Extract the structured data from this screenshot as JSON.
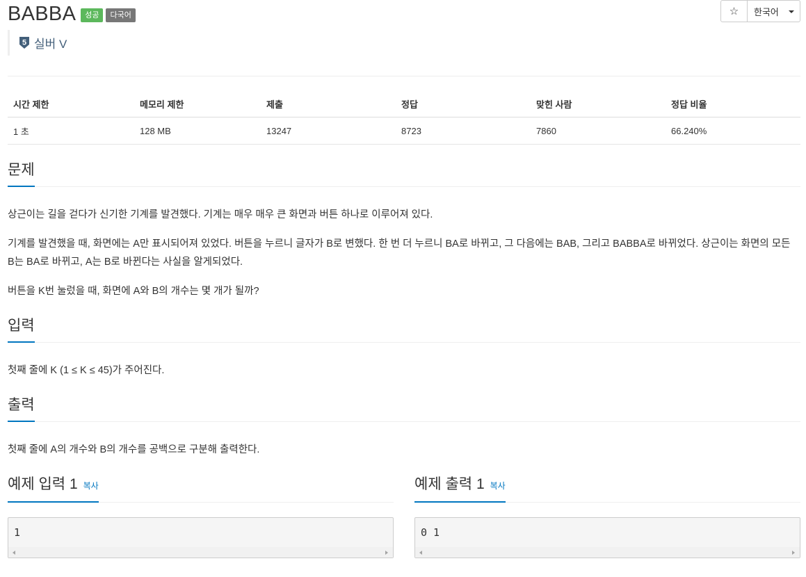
{
  "problem": {
    "title": "BABBA",
    "badges": {
      "success": "성공",
      "multilang": "다국어"
    },
    "tier": {
      "level": "5",
      "name": "실버 V",
      "color": "#435f7a"
    }
  },
  "toolbar": {
    "star_icon": "☆",
    "language": "한국어"
  },
  "info_table": {
    "headers": [
      "시간 제한",
      "메모리 제한",
      "제출",
      "정답",
      "맞힌 사람",
      "정답 비율"
    ],
    "values": [
      "1 초",
      "128 MB",
      "13247",
      "8723",
      "7860",
      "66.240%"
    ]
  },
  "sections": {
    "problem": {
      "heading": "문제",
      "paragraphs": [
        "상근이는 길을 걷다가 신기한 기계를 발견했다. 기계는 매우 매우 큰 화면과 버튼 하나로 이루어져 있다.",
        "기계를 발견했을 때, 화면에는 A만 표시되어져 있었다. 버튼을 누르니 글자가 B로 변했다. 한 번 더 누르니 BA로 바뀌고, 그 다음에는 BAB, 그리고 BABBA로 바뀌었다. 상근이는 화면의 모든 B는 BA로 바뀌고, A는 B로 바뀐다는 사실을 알게되었다.",
        "버튼을 K번 눌렀을 때, 화면에 A와 B의 개수는 몇 개가 될까?"
      ]
    },
    "input": {
      "heading": "입력",
      "text": "첫째 줄에 K (1 ≤ K ≤ 45)가 주어진다."
    },
    "output": {
      "heading": "출력",
      "text": "첫째 줄에 A의 개수와 B의 개수를 공백으로 구분해 출력한다."
    }
  },
  "samples": {
    "input": {
      "heading": "예제 입력 1",
      "copy": "복사",
      "content": "1"
    },
    "output": {
      "heading": "예제 출력 1",
      "copy": "복사",
      "content": "0 1"
    }
  },
  "colors": {
    "accent": "#0076c0",
    "success": "#5cb85c",
    "multilang": "#777777"
  }
}
